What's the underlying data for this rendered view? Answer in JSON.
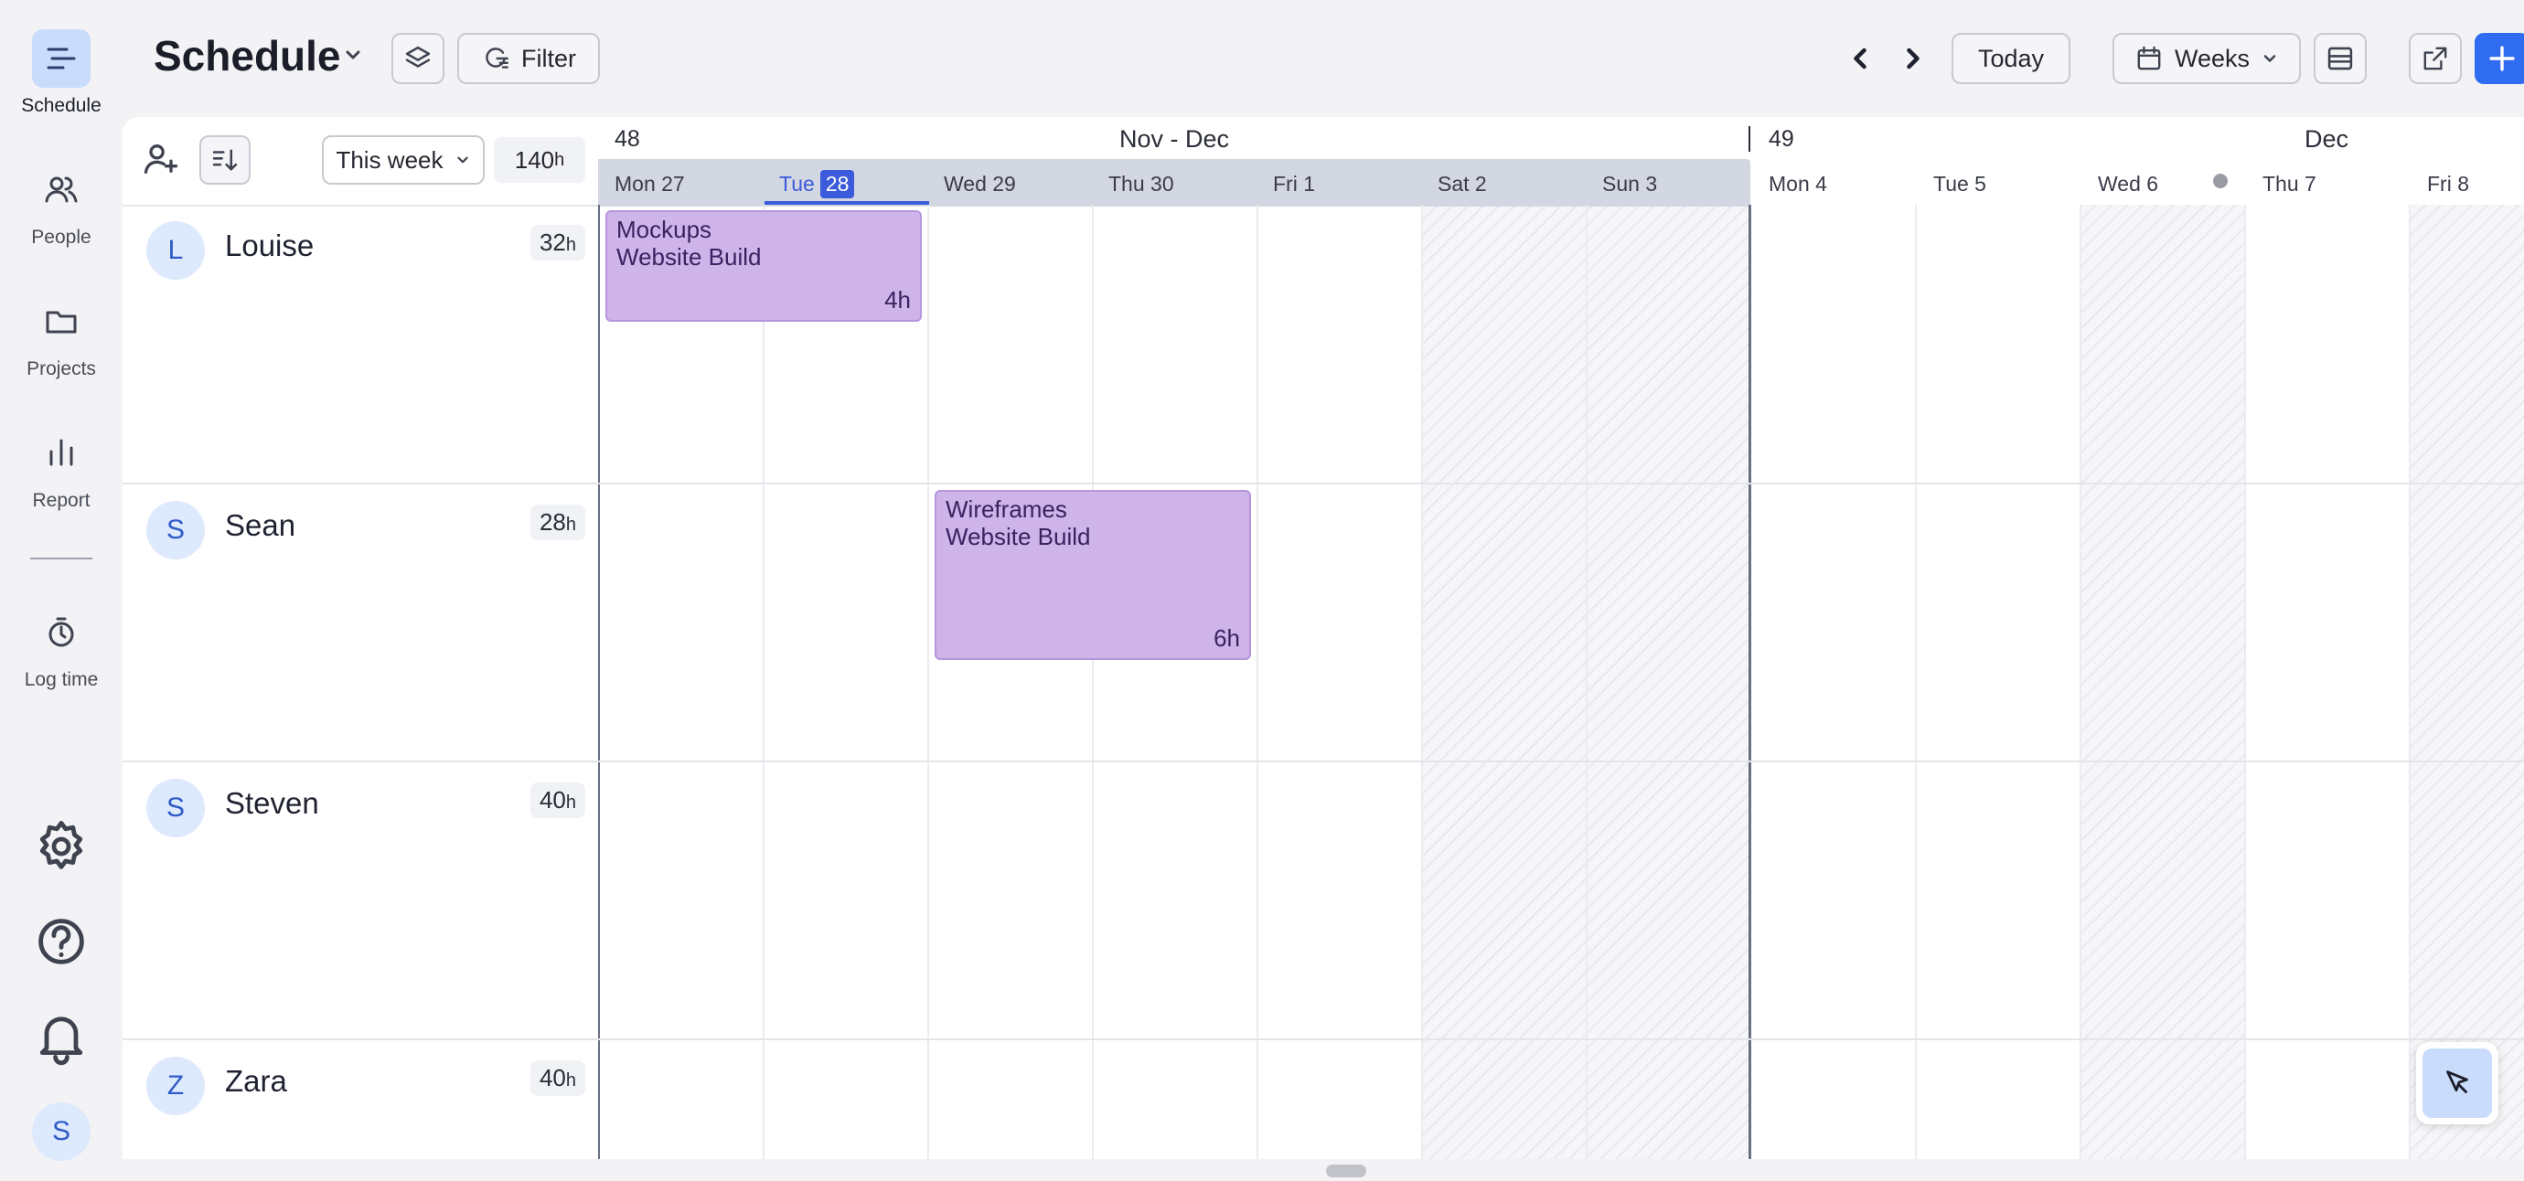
{
  "nav": {
    "items": [
      {
        "label": "Schedule",
        "icon": "schedule-icon",
        "active": true
      },
      {
        "label": "People",
        "icon": "people-icon"
      },
      {
        "label": "Projects",
        "icon": "folder-icon"
      },
      {
        "label": "Report",
        "icon": "bar-chart-icon"
      },
      {
        "label": "Log time",
        "icon": "stopwatch-icon"
      }
    ],
    "avatar_initial": "S"
  },
  "header": {
    "title": "Schedule",
    "filter_label": "Filter",
    "today_label": "Today",
    "view_label": "Weeks"
  },
  "people_panel": {
    "range_label": "This week",
    "total_hours": "140",
    "hours_unit": "h"
  },
  "people": [
    {
      "initial": "L",
      "name": "Louise",
      "hours": "32",
      "unit": "h"
    },
    {
      "initial": "S",
      "name": "Sean",
      "hours": "28",
      "unit": "h"
    },
    {
      "initial": "S",
      "name": "Steven",
      "hours": "40",
      "unit": "h"
    },
    {
      "initial": "Z",
      "name": "Zara",
      "hours": "40",
      "unit": "h"
    }
  ],
  "weeks": [
    {
      "number": "48",
      "month": "Nov - Dec"
    },
    {
      "number": "49",
      "month": "Dec"
    }
  ],
  "days": [
    {
      "label": "Mon 27"
    },
    {
      "label": "Tue",
      "badge": "28",
      "today": true
    },
    {
      "label": "Wed 29"
    },
    {
      "label": "Thu 30"
    },
    {
      "label": "Fri 1"
    },
    {
      "label": "Sat 2",
      "weekend": true
    },
    {
      "label": "Sun 3",
      "weekend": true
    },
    {
      "label": "Mon 4"
    },
    {
      "label": "Tue 5"
    },
    {
      "label": "Wed 6",
      "holiday": true
    },
    {
      "label": "Thu 7"
    },
    {
      "label": "Fri 8",
      "weekend": true
    }
  ],
  "events": [
    {
      "title": "Mockups",
      "project": "Website Build",
      "duration": "4h",
      "color": "#cfb4ea"
    },
    {
      "title": "Wireframes",
      "project": "Website Build",
      "duration": "6h",
      "color": "#cfb4ea"
    }
  ],
  "colors": {
    "accent": "#2f6cf0",
    "today": "#3b5bdb",
    "event": "#cfb4ea"
  }
}
